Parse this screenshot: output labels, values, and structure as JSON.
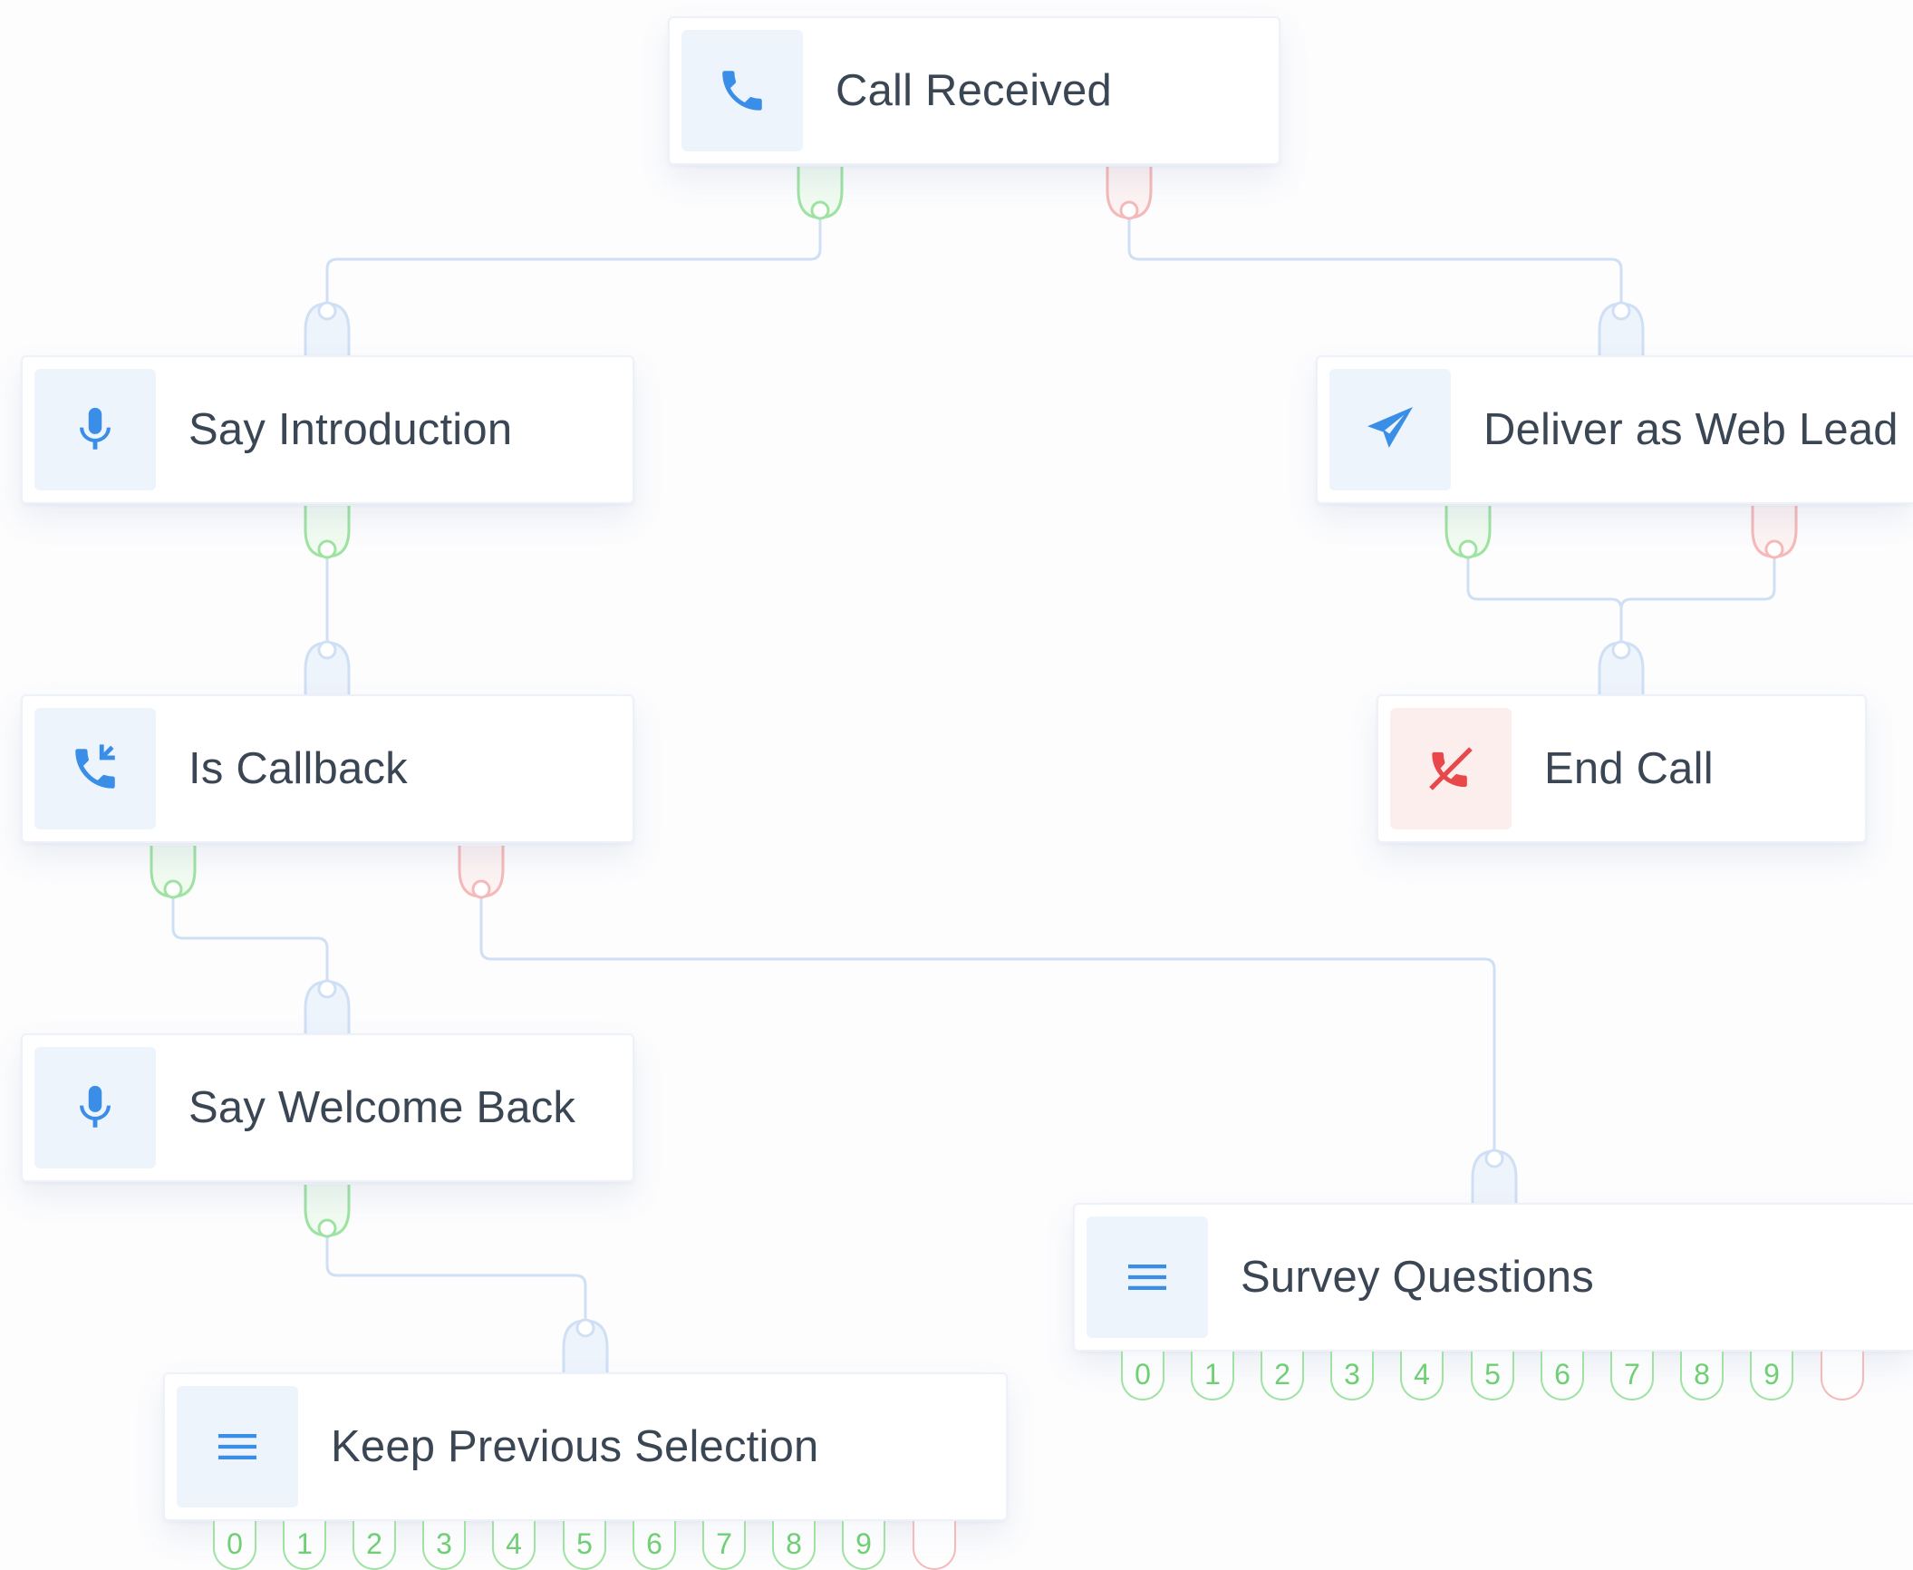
{
  "nodes": {
    "call_received": {
      "label": "Call Received",
      "icon": "phone-icon"
    },
    "say_introduction": {
      "label": "Say Introduction",
      "icon": "microphone-icon"
    },
    "deliver_web_lead": {
      "label": "Deliver as Web Lead",
      "icon": "paper-plane-icon"
    },
    "is_callback": {
      "label": "Is Callback",
      "icon": "phone-callback-icon"
    },
    "end_call": {
      "label": "End Call",
      "icon": "phone-hangup-icon"
    },
    "say_welcome_back": {
      "label": "Say Welcome Back",
      "icon": "microphone-icon"
    },
    "survey_questions": {
      "label": "Survey Questions",
      "icon": "menu-lines-icon",
      "keys": [
        "0",
        "1",
        "2",
        "3",
        "4",
        "5",
        "6",
        "7",
        "8",
        "9"
      ]
    },
    "keep_previous_selection": {
      "label": "Keep Previous Selection",
      "icon": "menu-lines-icon",
      "keys": [
        "0",
        "1",
        "2",
        "3",
        "4",
        "5",
        "6",
        "7",
        "8",
        "9"
      ]
    }
  },
  "colors": {
    "accent_blue": "#3b8ee8",
    "success_green": "#9fe3a2",
    "danger_red": "#f5b9b9",
    "wire": "#cfe0f5",
    "end_call_red": "#e8484a"
  }
}
